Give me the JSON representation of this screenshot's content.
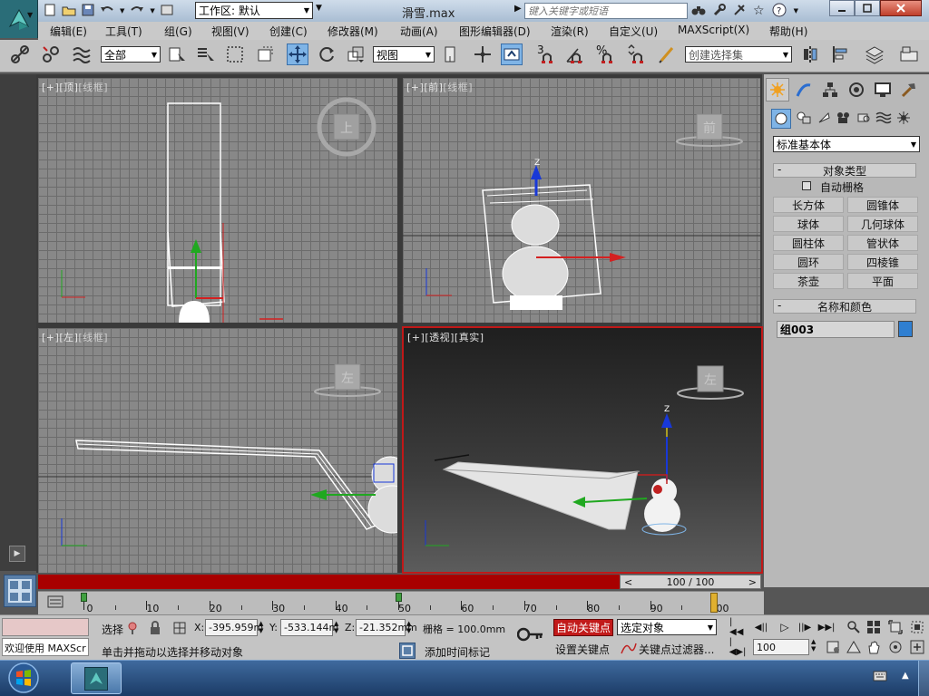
{
  "titlebar": {
    "workspace_label": "工作区: 默认",
    "file_title": "滑雪.max",
    "search_placeholder": "键入关键字或短语"
  },
  "menu": [
    "编辑(E)",
    "工具(T)",
    "组(G)",
    "视图(V)",
    "创建(C)",
    "修改器(M)",
    "动画(A)",
    "图形编辑器(D)",
    "渲染(R)",
    "自定义(U)",
    "MAXScript(X)",
    "帮助(H)"
  ],
  "toolbar": {
    "selection_filter": "全部",
    "ref_coord": "视图",
    "snap_num": "3",
    "percent_snap": "%",
    "named_sel_placeholder": "创建选择集"
  },
  "viewports": {
    "top": {
      "label_plus": "[+]",
      "label_view": "[顶]",
      "label_mode": "[线框]",
      "cube_text": "上"
    },
    "front": {
      "label_plus": "[+]",
      "label_view": "[前]",
      "label_mode": "[线框]",
      "cube_text": "前"
    },
    "left": {
      "label_plus": "[+]",
      "label_view": "[左]",
      "label_mode": "[线框]",
      "cube_text": "左"
    },
    "persp": {
      "label_plus": "[+]",
      "label_view": "[透视]",
      "label_mode": "[真实]",
      "cube_text": "左"
    }
  },
  "axis_label_z": "Z",
  "command_panel": {
    "category_dropdown": "标准基本体",
    "object_type_header": "对象类型",
    "autogrid_label": "自动栅格",
    "buttons": [
      "长方体",
      "圆锥体",
      "球体",
      "几何球体",
      "圆柱体",
      "管状体",
      "圆环",
      "四棱锥",
      "茶壶",
      "平面"
    ],
    "name_color_header": "名称和颜色",
    "object_name": "组003",
    "object_color": "#2f7fd1",
    "minus": "-"
  },
  "timeline": {
    "frame_display": "100 / 100",
    "prev_arrow": "<",
    "next_arrow": ">",
    "ticks": [
      "0",
      "10",
      "20",
      "30",
      "40",
      "50",
      "60",
      "70",
      "80",
      "90",
      "100"
    ],
    "current_frame": 100
  },
  "status": {
    "maxscript_listener": "欢迎使用 MAXScr",
    "selection_label": "选择",
    "x_label": "X:",
    "x_value": "-395.959m",
    "y_label": "Y:",
    "y_value": "-533.144m",
    "z_label": "Z:",
    "z_value": "-21.352mm",
    "grid_text": "栅格 = 100.0mm",
    "prompt": "单击并拖动以选择并移动对象",
    "add_time_tag": "添加时间标记",
    "auto_key": "自动关键点",
    "set_key": "设置关键点",
    "key_mode_dropdown": "选定对象",
    "key_filters": "关键点过滤器...",
    "current_frame_field": "100"
  },
  "colors": {
    "auto_key_red": "#c21a1a",
    "active_border": "#c01818",
    "timebar_red": "#a80000",
    "gizmo_x": "#d42020",
    "gizmo_y": "#20a820",
    "gizmo_z": "#1838d8"
  }
}
